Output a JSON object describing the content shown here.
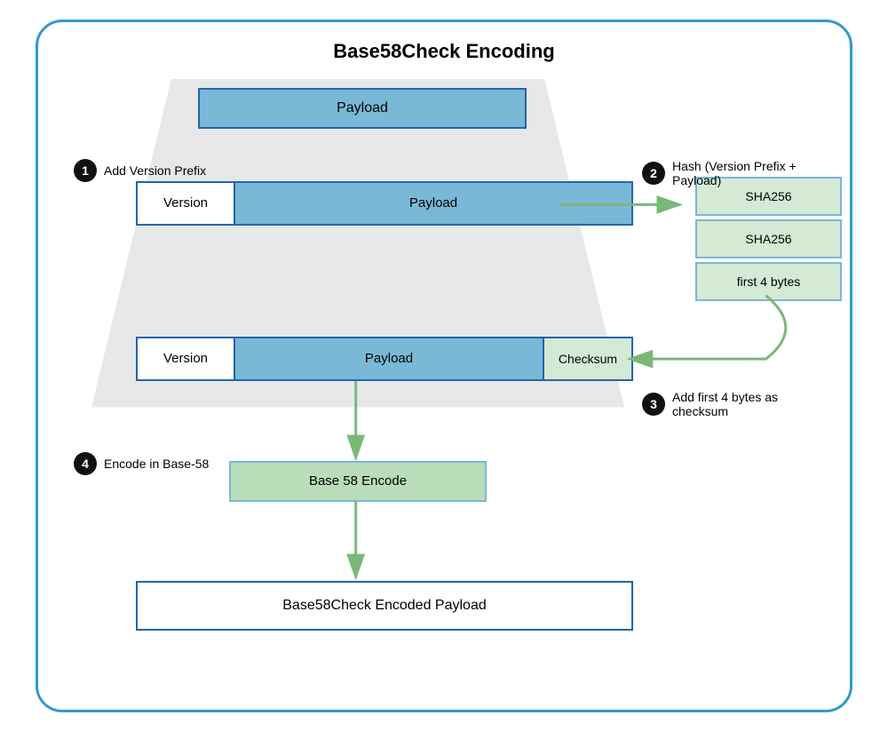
{
  "title": "Base58Check Encoding",
  "payload_top": "Payload",
  "step1": {
    "number": "1",
    "label": "Add Version Prefix"
  },
  "step2": {
    "number": "2",
    "label": "Hash (Version Prefix + Payload)"
  },
  "step3": {
    "number": "3",
    "label": "Add first 4 bytes as checksum"
  },
  "step4": {
    "number": "4",
    "label": "Encode in Base-58"
  },
  "row1": {
    "version": "Version",
    "payload": "Payload"
  },
  "row2": {
    "version": "Version",
    "payload": "Payload",
    "checksum": "Checksum"
  },
  "hash_boxes": [
    "SHA256",
    "SHA256",
    "first 4 bytes"
  ],
  "base58_encode": "Base 58 Encode",
  "final_box": "Base58Check Encoded Payload"
}
